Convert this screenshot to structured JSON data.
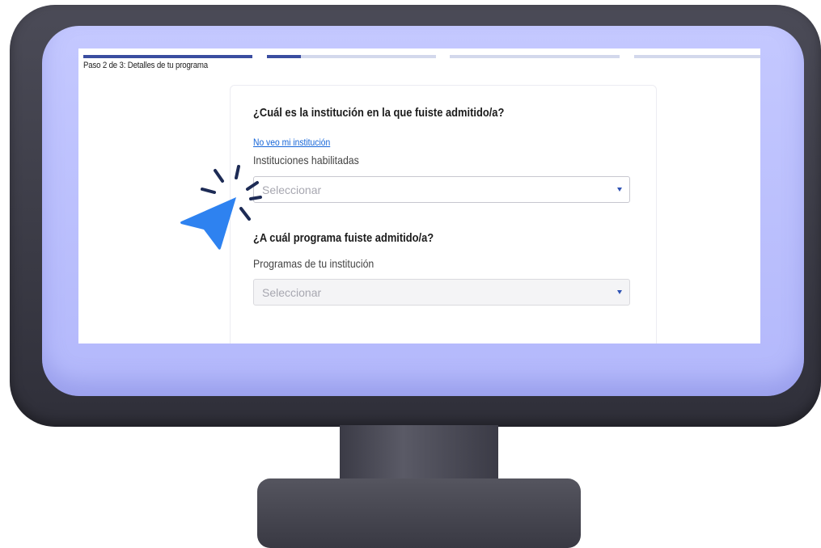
{
  "progress": {
    "step_text": "Paso 2 de 3: Detalles de tu programa",
    "segments": [
      {
        "fill": 1.0
      },
      {
        "fill": 0.2
      },
      {
        "fill": 0.0
      },
      {
        "fill": 0.0
      }
    ]
  },
  "form": {
    "institution": {
      "question": "¿Cuál es la institución en la que fuiste admitido/a?",
      "link": "No veo mi institución",
      "label": "Instituciones habilitadas",
      "placeholder": "Seleccionar"
    },
    "program": {
      "question": "¿A cuál programa fuiste admitido/a?",
      "label": "Programas de tu institución",
      "placeholder": "Seleccionar"
    }
  },
  "colors": {
    "accent": "#3a4da0",
    "link": "#1565d8",
    "cursor": "#2e82f0",
    "bezel": "#b8bdfd",
    "frame": "#3a3a45"
  },
  "icons": {
    "cursor": "pointer-arrow-icon",
    "caret": "caret-down-icon"
  }
}
